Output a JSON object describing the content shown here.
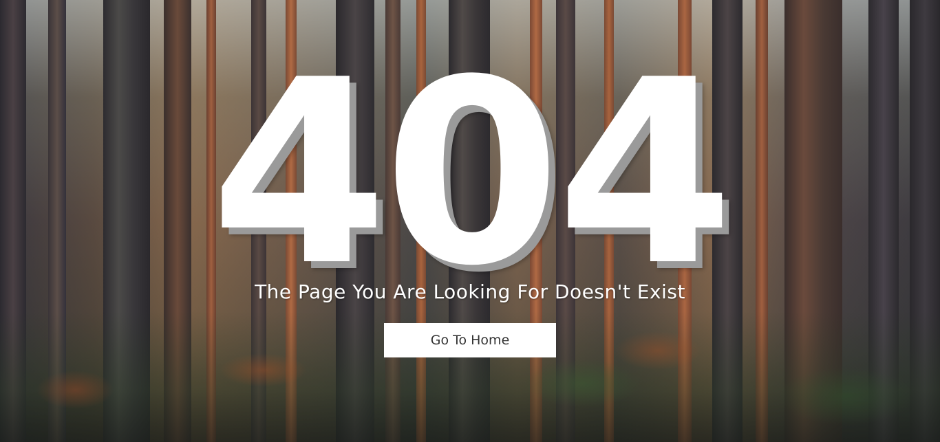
{
  "error": {
    "code": "404",
    "message": "The Page You Are Looking For Doesn't Exist"
  },
  "actions": {
    "home_label": "Go To Home"
  },
  "background": {
    "scene": "pine forest",
    "trunk_color": "#3a302c",
    "bark_highlight": "#8b5a3c"
  }
}
